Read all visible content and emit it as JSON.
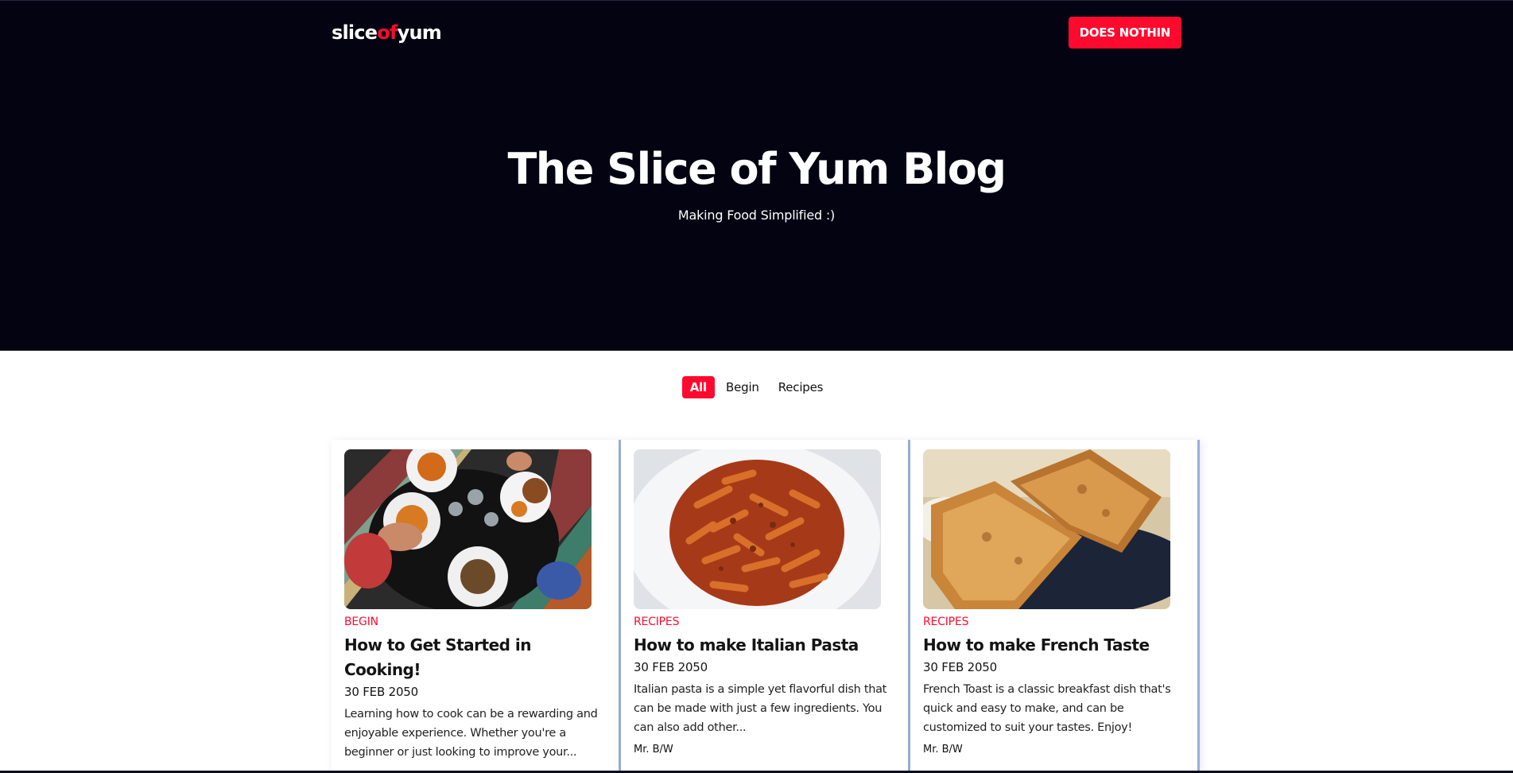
{
  "brand": {
    "logo_part1": "slice",
    "logo_part2": "of",
    "logo_part3": "yum"
  },
  "nav": {
    "button_label": "DOES NOTHIN"
  },
  "hero": {
    "title": "The Slice of Yum Blog",
    "subtitle": "Making Food Simplified :)"
  },
  "filters": [
    {
      "label": "All",
      "active": true
    },
    {
      "label": "Begin",
      "active": false
    },
    {
      "label": "Recipes",
      "active": false
    }
  ],
  "posts": [
    {
      "category": "Begin",
      "title": "How to Get Started in Cooking!",
      "date": "30 FEB 2050",
      "excerpt": "Learning how to cook can be a rewarding and enjoyable experience. Whether you're a beginner or just looking to improve your...",
      "author": ""
    },
    {
      "category": "Recipes",
      "title": "How to make Italian Pasta",
      "date": "30 FEB 2050",
      "excerpt": "Italian pasta is a simple yet flavorful dish that can be made with just a few ingredients. You can also add other...",
      "author": "Mr. B/W"
    },
    {
      "category": "Recipes",
      "title": "How to make French Taste",
      "date": "30 FEB 2050",
      "excerpt": "French Toast is a classic breakfast dish that's quick and easy to make, and can be customized to suit your tastes. Enjoy!",
      "author": "Mr. B/W"
    }
  ],
  "colors": {
    "accent": "#ff0a2e",
    "hero_bg": "#030312"
  }
}
